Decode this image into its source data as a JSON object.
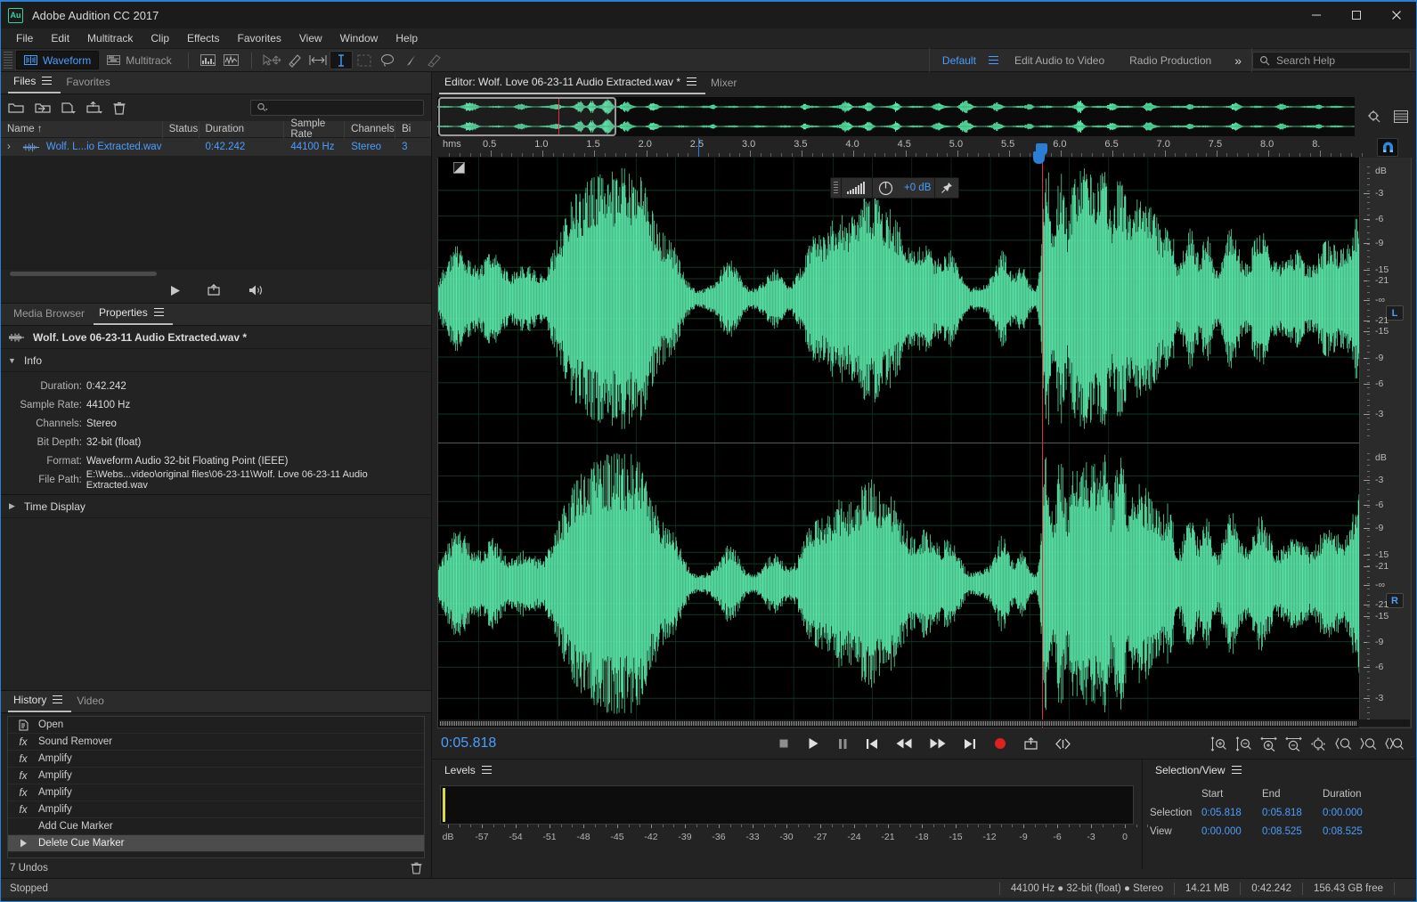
{
  "window": {
    "app_icon": "au-logo-icon",
    "title": "Adobe Audition CC 2017",
    "minimize": "—",
    "maximize": "❐",
    "close": "✕"
  },
  "menubar": {
    "items": [
      "File",
      "Edit",
      "Multitrack",
      "Clip",
      "Effects",
      "Favorites",
      "View",
      "Window",
      "Help"
    ]
  },
  "toolbar": {
    "waveform_label": "Waveform",
    "multitrack_label": "Multitrack",
    "icons": [
      "spectral-frequency-display-icon",
      "spectral-pitch-display-icon",
      "move-tool-icon",
      "slip-tool-icon",
      "razor-tool-icon",
      "time-selection-tool-icon",
      "marquee-selection-tool-icon",
      "lasso-selection-tool-icon",
      "paintbrush-selection-tool-icon",
      "spot-healing-brush-tool-icon"
    ],
    "workspaces": [
      "Default",
      "Edit Audio to Video",
      "Radio Production"
    ],
    "active_workspace": "Default",
    "more_label": "»",
    "search_placeholder": "Search Help"
  },
  "files_panel": {
    "tabs": [
      {
        "label": "Files",
        "active": true,
        "menu": true
      },
      {
        "label": "Favorites",
        "active": false,
        "menu": false
      }
    ],
    "toolbar_icons": [
      "open-file-icon",
      "import-file-icon",
      "new-file-icon",
      "export-file-icon",
      "close-file-icon"
    ],
    "search_placeholder": "",
    "columns": [
      "Name",
      "Status",
      "Duration",
      "Sample Rate",
      "Channels",
      "Bi"
    ],
    "sort_indicator": "↑",
    "rows": [
      {
        "expand": "›",
        "icon": "waveform-icon",
        "name": "Wolf. L...io Extracted.wav *",
        "status": "",
        "duration": "0:42.242",
        "sample_rate": "44100 Hz",
        "channels": "Stereo",
        "bit_depth": "3"
      }
    ],
    "transport_icons": [
      "play-icon",
      "loop-icon",
      "volume-icon"
    ]
  },
  "properties_panel": {
    "tabs": [
      {
        "label": "Media Browser",
        "active": false,
        "menu": false
      },
      {
        "label": "Properties",
        "active": true,
        "menu": true
      }
    ],
    "file_title": "Wolf. Love 06-23-11 Audio Extracted.wav *",
    "file_icon": "waveform-icon",
    "sections": [
      {
        "label": "Info",
        "expanded": true
      },
      {
        "label": "Time Display",
        "expanded": false
      }
    ],
    "info": [
      {
        "label": "Duration:",
        "value": "0:42.242"
      },
      {
        "label": "Sample Rate:",
        "value": "44100 Hz"
      },
      {
        "label": "Channels:",
        "value": "Stereo"
      },
      {
        "label": "Bit Depth:",
        "value": "32-bit (float)"
      },
      {
        "label": "Format:",
        "value": "Waveform Audio 32-bit Floating Point (IEEE)"
      },
      {
        "label": "File Path:",
        "value": "E:\\Webs...video\\original files\\06-23-11\\Wolf. Love 06-23-11 Audio Extracted.wav"
      }
    ]
  },
  "history_panel": {
    "tabs": [
      {
        "label": "History",
        "active": true,
        "menu": true
      },
      {
        "label": "Video",
        "active": false,
        "menu": false
      }
    ],
    "items": [
      {
        "icon": "open-document-icon",
        "label": "Open",
        "selected": false
      },
      {
        "icon": "fx-icon",
        "label": "Sound Remover",
        "selected": false
      },
      {
        "icon": "fx-icon",
        "label": "Amplify",
        "selected": false
      },
      {
        "icon": "fx-icon",
        "label": "Amplify",
        "selected": false
      },
      {
        "icon": "fx-icon",
        "label": "Amplify",
        "selected": false
      },
      {
        "icon": "fx-icon",
        "label": "Amplify",
        "selected": false
      },
      {
        "icon": "",
        "label": "Add Cue Marker",
        "selected": false
      },
      {
        "icon": "current-state-arrow-icon",
        "label": "Delete Cue Marker",
        "selected": true
      }
    ],
    "undo_count": "7 Undos",
    "delete_icon": "trash-icon"
  },
  "editor": {
    "tabs": [
      {
        "label": "Editor: Wolf. Love 06-23-11 Audio Extracted.wav *",
        "active": true,
        "menu": true
      },
      {
        "label": "Mixer",
        "active": false,
        "menu": false
      }
    ],
    "side_icons": [
      "zoom-fit-icon",
      "layout-icon"
    ],
    "snap_toggle": {
      "icon": "magnet-icon",
      "active": true
    },
    "timeline_unit": "hms",
    "timeline_ticks": [
      "0.5",
      "1.0",
      "1.5",
      "2.0",
      "2.5",
      "3.0",
      "3.5",
      "4.0",
      "4.5",
      "5.0",
      "5.5",
      "6.0",
      "6.5",
      "7.0",
      "7.5",
      "8.0",
      "8."
    ],
    "hud": {
      "meter_icon": "level-meter-icon",
      "knob_icon": "gain-knob-icon",
      "gain_value": "+0 dB",
      "pin_icon": "pin-icon"
    },
    "db_scale_top": [
      "dB",
      "-3",
      "-6",
      "-9",
      "-15",
      "-21",
      "-∞",
      "-21",
      "-15",
      "-9",
      "-6",
      "-3"
    ],
    "db_scale_bottom": [
      "dB",
      "-3",
      "-6",
      "-9",
      "-15",
      "-21",
      "-∞",
      "-21",
      "-15",
      "-9",
      "-6",
      "-3"
    ],
    "channel_left_label": "L",
    "channel_right_label": "R",
    "waveform_color": "#5ae6a8",
    "playhead_color": "#e03030",
    "transport": {
      "timecode": "0:05.818",
      "buttons": [
        "stop-button",
        "play-button",
        "pause-button",
        "skip-to-start-button",
        "rewind-button",
        "fast-forward-button",
        "skip-to-end-button",
        "record-button",
        "loop-playback-button",
        "skip-selection-button"
      ]
    },
    "zoom_buttons": [
      "zoom-in-amplitude-icon",
      "zoom-out-amplitude-icon",
      "zoom-in-time-icon",
      "zoom-out-time-icon",
      "zoom-out-full-icon",
      "zoom-to-selection-in-point-icon",
      "zoom-to-selection-out-point-icon",
      "zoom-to-selection-icon"
    ]
  },
  "levels_panel": {
    "tab_label": "Levels",
    "menu": true,
    "scale": [
      "dB",
      "-57",
      "-54",
      "-51",
      "-48",
      "-45",
      "-42",
      "-39",
      "-36",
      "-33",
      "-30",
      "-27",
      "-24",
      "-21",
      "-18",
      "-15",
      "-12",
      "-9",
      "-6",
      "-3",
      "0"
    ]
  },
  "selection_view_panel": {
    "tab_label": "Selection/View",
    "menu": true,
    "columns": [
      "",
      "Start",
      "End",
      "Duration"
    ],
    "rows": [
      {
        "label": "Selection",
        "start": "0:05.818",
        "end": "0:05.818",
        "duration": "0:00.000"
      },
      {
        "label": "View",
        "start": "0:00.000",
        "end": "0:08.525",
        "duration": "0:08.525"
      }
    ]
  },
  "statusbar": {
    "state": "Stopped",
    "cells": [
      "44100 Hz ● 32-bit (float) ● Stereo",
      "14.21 MB",
      "0:42.242",
      "156.43 GB free"
    ]
  },
  "colors": {
    "accent_blue": "#4a9eff",
    "waveform_green": "#5ae6a8",
    "record_red": "#e02020",
    "playhead_red": "#e03030",
    "panel_bg": "#232323",
    "wave_bg": "#000000"
  }
}
